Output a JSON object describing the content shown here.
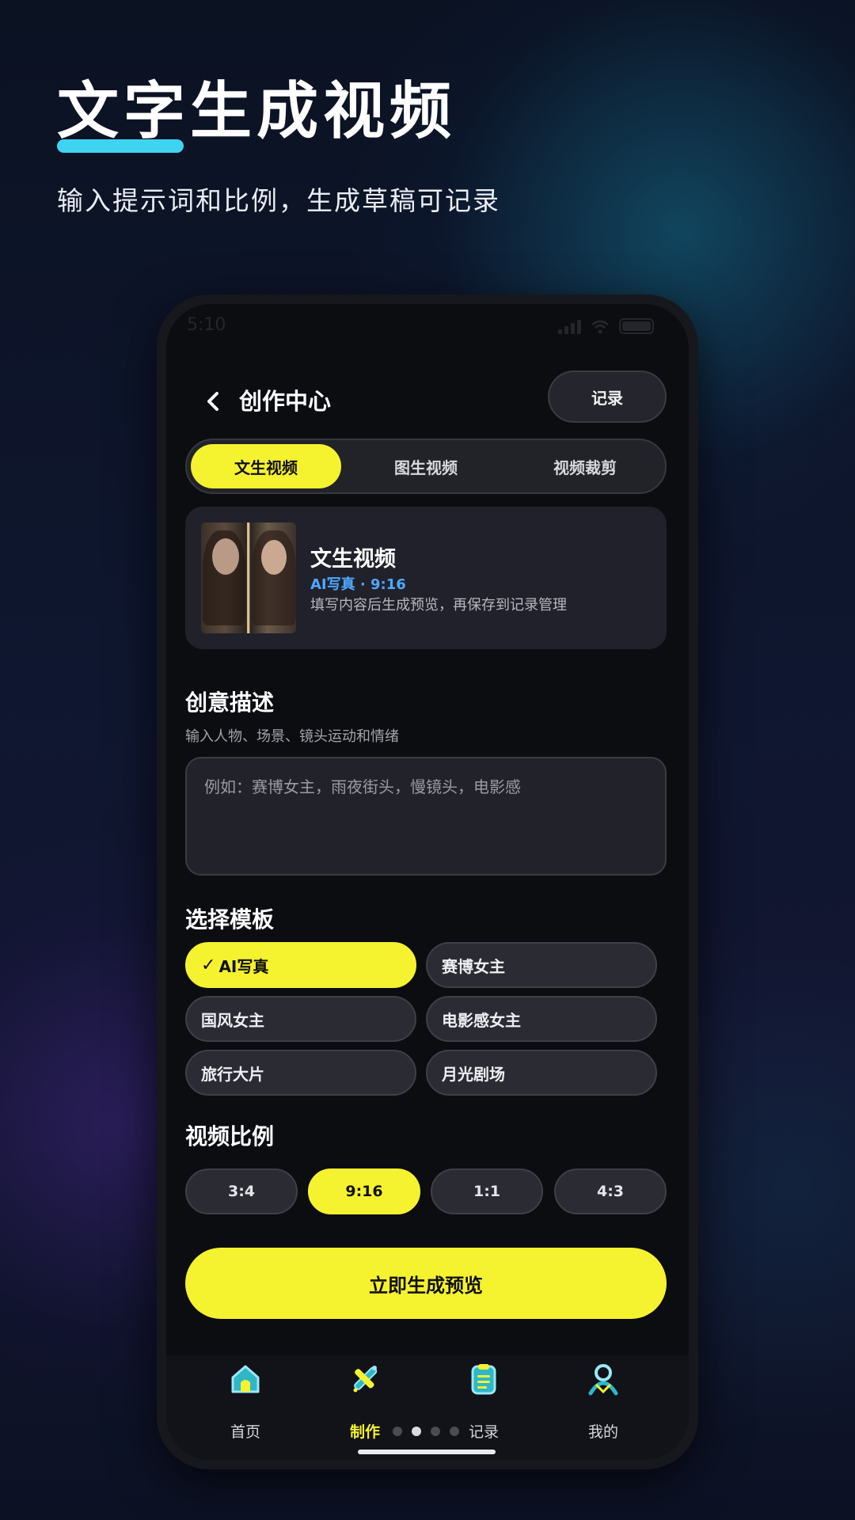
{
  "hero": {
    "title": "文字生成视频",
    "subtitle": "输入提示词和比例，生成草稿可记录"
  },
  "status_bar": {
    "time": "5:10"
  },
  "header": {
    "back_icon": "chevron-left-icon",
    "title": "创作中心",
    "record_label": "记录"
  },
  "tabs": [
    {
      "label": "文生视频",
      "active": true
    },
    {
      "label": "图生视频",
      "active": false
    },
    {
      "label": "视频裁剪",
      "active": false
    }
  ],
  "info_card": {
    "title": "文生视频",
    "tag": "AI写真 · 9:16",
    "description": "填写内容后生成预览，再保存到记录管理"
  },
  "description_section": {
    "title": "创意描述",
    "hint": "输入人物、场景、镜头运动和情绪",
    "placeholder": "例如：赛博女主，雨夜街头，慢镜头，电影感",
    "value": ""
  },
  "template_section": {
    "title": "选择模板",
    "selected_mark": "✓",
    "options": [
      {
        "label": "AI写真",
        "selected": true
      },
      {
        "label": "赛博女主",
        "selected": false
      },
      {
        "label": "国风女主",
        "selected": false
      },
      {
        "label": "电影感女主",
        "selected": false
      },
      {
        "label": "旅行大片",
        "selected": false
      },
      {
        "label": "月光剧场",
        "selected": false
      }
    ]
  },
  "ratio_section": {
    "title": "视频比例",
    "options": [
      {
        "label": "3:4",
        "selected": false
      },
      {
        "label": "9:16",
        "selected": true
      },
      {
        "label": "1:1",
        "selected": false
      },
      {
        "label": "4:3",
        "selected": false
      }
    ]
  },
  "generate_button": {
    "label": "立即生成预览"
  },
  "bottom_nav": [
    {
      "label": "首页",
      "icon": "home-icon",
      "active": false
    },
    {
      "label": "制作",
      "icon": "magic-wand-icon",
      "active": true
    },
    {
      "label": "记录",
      "icon": "clipboard-icon",
      "active": false
    },
    {
      "label": "我的",
      "icon": "user-icon",
      "active": false
    }
  ],
  "page_indicator": {
    "count": 4,
    "current": 2
  },
  "colors": {
    "accent_yellow": "#f5f22f",
    "accent_cyan": "#3fd3f2",
    "tag_blue": "#4ea8ff",
    "screen_bg": "#0c0d11"
  }
}
